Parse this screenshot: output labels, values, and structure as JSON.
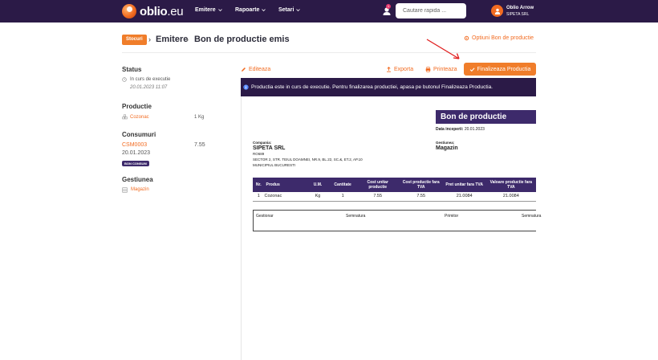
{
  "brand": {
    "name": "oblio",
    "tld": ".eu"
  },
  "nav": {
    "items": [
      "Emitere",
      "Rapoarte",
      "Setari"
    ],
    "notif_count": "1",
    "search_placeholder": "Cautare rapida ...",
    "user_name": "Oblio Arrow",
    "user_company": "SIPETA SRL"
  },
  "header": {
    "crumbs": [
      "Stocuri",
      "Emitere",
      "Bon de productie emis"
    ],
    "options_label": "Optiuni Bon de productie"
  },
  "left": {
    "status_label": "Status",
    "status_value": "In curs de executie",
    "status_date": "20.01.2023 11:07",
    "productie_label": "Productie",
    "productie_item": "Cozonac",
    "productie_qty": "1 Kg",
    "consumuri_label": "Consumuri",
    "consum_code": "CSM0003",
    "consum_value": "7.55",
    "consum_date": "20.01.2023",
    "consum_badge": "BON CONSUM",
    "gestiunea_label": "Gestiunea",
    "gestiunea_value": "Magazin"
  },
  "toolbar": {
    "edit_label": "Editeaza",
    "export_label": "Exporta",
    "print_label": "Printeaza",
    "finalize_label": "Finalizeaza Productia"
  },
  "info": {
    "message": "Productia este in curs de executie. Pentru finalizarea productiei, apasa pe butonul Finalizeaza Productia."
  },
  "document": {
    "title": "Bon de productie",
    "date_label": "Data inceperii:",
    "date_value": "20.01.2023",
    "company_label": "Compania:",
    "company_name": "SIPETA SRL",
    "company_id": "RO689",
    "address_line1": "SECTOR 2, STR. TEIUL DOAMNEI, NR.9, BL.22, SC.&, ET.2, AP.10",
    "address_line2": "MUNICIPIUL BUCURESTI",
    "gestiune_label": "Gestiunea:",
    "gestiune_value": "Magazin",
    "columns": [
      "Nr.",
      "Produs",
      "U.M.",
      "Cantitate",
      "Cost unitar productie",
      "Cost productie fara TVA",
      "Pret unitar fara TVA",
      "Valoare productie fara TVA"
    ],
    "rows": [
      [
        "1",
        "Cozonac",
        "Kg",
        "1",
        "7.55",
        "7.55",
        "21.0084",
        "21.0084"
      ]
    ],
    "signatures": [
      "Gestionar",
      "Semnatura",
      "Primitor",
      "Semnatura"
    ]
  },
  "colors": {
    "navbar": "#2b1a47",
    "accent": "#f07d2a",
    "doc_header": "#3d2a6b"
  }
}
